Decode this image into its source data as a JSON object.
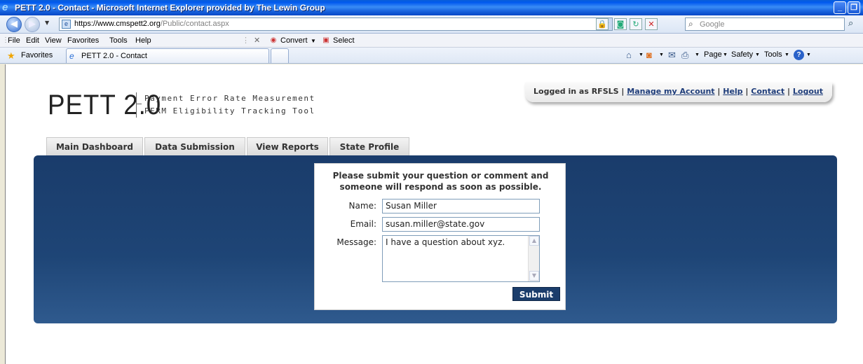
{
  "window": {
    "title": "PETT 2.0 - Contact - Microsoft Internet Explorer provided by The Lewin Group",
    "minimize_glyph": "_",
    "restore_glyph": "❐"
  },
  "address_bar": {
    "url_prefix": "https://www.",
    "url_domain": "cmspett2.org",
    "url_path": "/Public/contact.aspx",
    "search_placeholder": "Google"
  },
  "menu": {
    "items": [
      "File",
      "Edit",
      "View",
      "Favorites",
      "Tools",
      "Help"
    ],
    "convert_label": "Convert",
    "select_label": "Select"
  },
  "favorites_bar": {
    "favorites_label": "Favorites",
    "tab_title": "PETT 2.0 - Contact",
    "commands": [
      "Page",
      "Safety",
      "Tools"
    ]
  },
  "site": {
    "logo_text": "PETT 2.0",
    "logo_line1": "Payment Error Rate Measurement",
    "logo_line2": "PERM Eligibility Tracking Tool",
    "user_bar": {
      "logged_in_text": "Logged in as RFSLS",
      "links": [
        "Manage my Account",
        "Help",
        "Contact",
        "Logout"
      ]
    },
    "nav_tabs": [
      "Main Dashboard",
      "Data Submission",
      "View Reports",
      "State Profile"
    ]
  },
  "contact_form": {
    "heading_line1": "Please submit your question or comment and",
    "heading_line2": "someone will respond as soon as possible.",
    "name_label": "Name:",
    "name_value": "Susan Miller",
    "email_label": "Email:",
    "email_value": "susan.miller@state.gov",
    "message_label": "Message:",
    "message_value": "I have a question about xyz.",
    "submit_label": "Submit"
  },
  "colors": {
    "panel_blue": "#1e4576",
    "submit_blue": "#1b3d6c",
    "link_blue": "#1f3d7a"
  }
}
